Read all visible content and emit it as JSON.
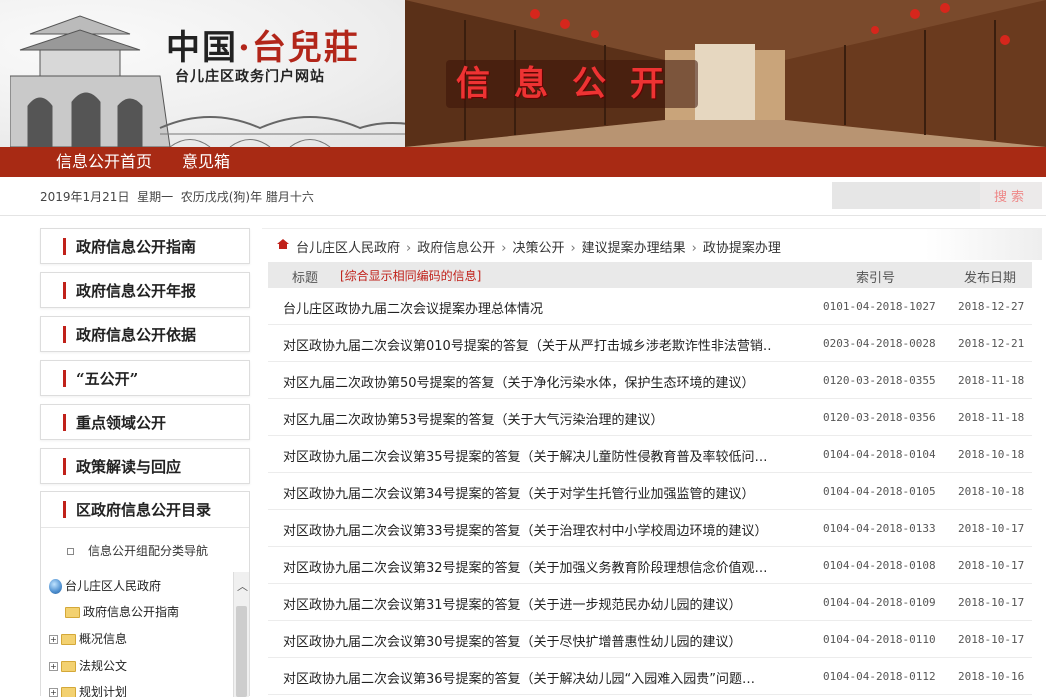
{
  "header": {
    "logo_main": "中国",
    "logo_dot": "·",
    "logo_red": "台兒莊",
    "logo_sub": "台儿庄区政务门户网站",
    "banner_title": "信息公开"
  },
  "nav": {
    "items": [
      {
        "label": "信息公开首页"
      },
      {
        "label": "意见箱"
      }
    ]
  },
  "datebar": {
    "date": "2019年1月21日",
    "weekday": "星期一",
    "lunar": "农历戊戌(狗)年 腊月十六",
    "search_placeholder": "",
    "search_label": "搜索"
  },
  "sidebar": {
    "items": [
      {
        "label": "政府信息公开指南"
      },
      {
        "label": "政府信息公开年报"
      },
      {
        "label": "政府信息公开依据"
      },
      {
        "label": "“五公开”"
      },
      {
        "label": "重点领域公开"
      },
      {
        "label": "政策解读与回应"
      }
    ],
    "group": {
      "title": "区政府信息公开目录",
      "sub_nav": "信息公开组配分类导航",
      "tree": [
        {
          "label": "台儿庄区人民政府",
          "icon": "globe-icon"
        },
        {
          "label": "政府信息公开指南",
          "icon": "folder-icon"
        },
        {
          "label": "概况信息",
          "icon": "folder-icon"
        },
        {
          "label": "法规公文",
          "icon": "folder-icon"
        },
        {
          "label": "规划计划",
          "icon": "folder-icon"
        }
      ]
    }
  },
  "breadcrumb": {
    "items": [
      "台儿庄区人民政府",
      "政府信息公开",
      "决策公开",
      "建议提案办理结果",
      "政协提案办理"
    ],
    "separator": "›"
  },
  "table": {
    "col_title": "标题",
    "hint": "[综合显示相同编码的信息]",
    "col_index": "索引号",
    "col_date": "发布日期",
    "rows": [
      {
        "title": "台儿庄区政协九届二次会议提案办理总体情况",
        "index": "0101-04-2018-1027",
        "date": "2018-12-27"
      },
      {
        "title": "对区政协九届二次会议第010号提案的答复（关于从严打击城乡涉老欺诈性非法营销…",
        "index": "0203-04-2018-0028",
        "date": "2018-12-21"
      },
      {
        "title": "对区九届二次政协第50号提案的答复（关于净化污染水体，保护生态环境的建议）",
        "index": "0120-03-2018-0355",
        "date": "2018-11-18"
      },
      {
        "title": "对区九届二次政协第53号提案的答复（关于大气污染治理的建议）",
        "index": "0120-03-2018-0356",
        "date": "2018-11-18"
      },
      {
        "title": "对区政协九届二次会议第35号提案的答复（关于解决儿童防性侵教育普及率较低问…",
        "index": "0104-04-2018-0104",
        "date": "2018-10-18"
      },
      {
        "title": "对区政协九届二次会议第34号提案的答复（关于对学生托管行业加强监管的建议）",
        "index": "0104-04-2018-0105",
        "date": "2018-10-18"
      },
      {
        "title": "对区政协九届二次会议第33号提案的答复（关于治理农村中小学校周边环境的建议）",
        "index": "0104-04-2018-0133",
        "date": "2018-10-17"
      },
      {
        "title": "对区政协九届二次会议第32号提案的答复（关于加强义务教育阶段理想信念价值观…",
        "index": "0104-04-2018-0108",
        "date": "2018-10-17"
      },
      {
        "title": "对区政协九届二次会议第31号提案的答复（关于进一步规范民办幼儿园的建议）",
        "index": "0104-04-2018-0109",
        "date": "2018-10-17"
      },
      {
        "title": "对区政协九届二次会议第30号提案的答复（关于尽快扩增普惠性幼儿园的建议）",
        "index": "0104-04-2018-0110",
        "date": "2018-10-17"
      },
      {
        "title": "对区政协九届二次会议第36号提案的答复（关于解决幼儿园“入园难入园贵”问题…",
        "index": "0104-04-2018-0112",
        "date": "2018-10-16"
      }
    ]
  },
  "colors": {
    "nav_bg": "#a82a14",
    "accent_red": "#c0211a",
    "table_header_bg": "#e9e9e9"
  }
}
